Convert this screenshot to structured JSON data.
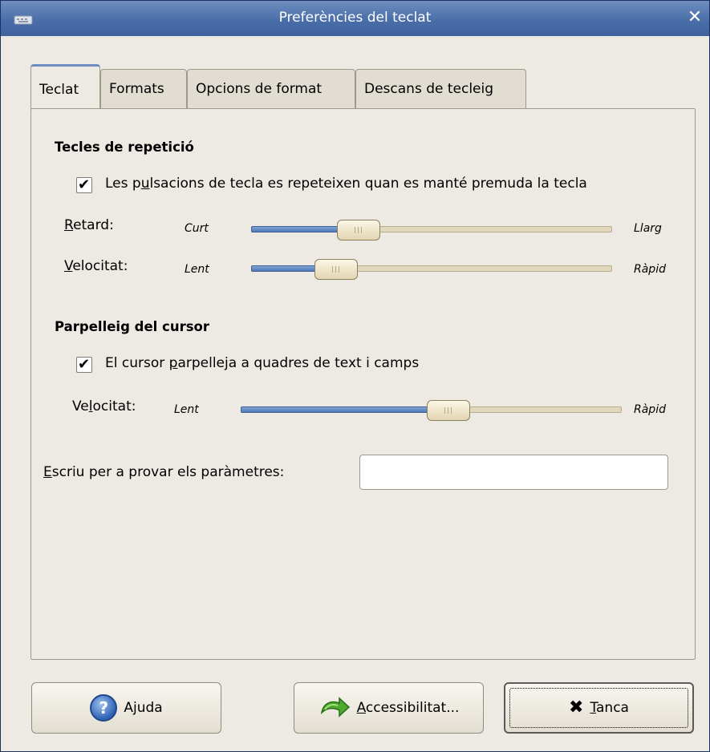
{
  "window": {
    "title": "Preferències del teclat",
    "close_glyph": "✕"
  },
  "tabs": [
    {
      "label": "Teclat",
      "active": true
    },
    {
      "label": "Formats",
      "active": false
    },
    {
      "label": "Opcions de format",
      "active": false
    },
    {
      "label": "Descans de tecleig",
      "active": false
    }
  ],
  "repeat": {
    "heading": "Tecles de repetició",
    "checkbox_label_pre": "Les p",
    "checkbox_label_mn": "u",
    "checkbox_label_post": "lsacions de tecla es repeteixen quan es manté premuda la tecla",
    "checked": true,
    "delay": {
      "label_mn": "R",
      "label_rest": "etard:",
      "min_label": "Curt",
      "max_label": "Llarg",
      "value": 0.27
    },
    "speed": {
      "label_mn": "V",
      "label_rest": "elocitat:",
      "min_label": "Lent",
      "max_label": "Ràpid",
      "value": 0.2
    }
  },
  "cursor": {
    "heading": "Parpelleig del cursor",
    "checkbox_label_pre": "El cursor ",
    "checkbox_label_mn": "p",
    "checkbox_label_post": "arpelleja a quadres de text i camps",
    "checked": true,
    "speed": {
      "label_pre": "Ve",
      "label_mn": "l",
      "label_rest": "ocitat:",
      "min_label": "Lent",
      "max_label": "Ràpid",
      "value": 0.55
    }
  },
  "test": {
    "label_mn": "E",
    "label_rest": "scriu per a provar els paràmetres:",
    "value": "",
    "placeholder": ""
  },
  "buttons": {
    "help": {
      "pre": "A",
      "mn": "j",
      "post": "uda",
      "icon": "help-icon"
    },
    "accessibility": {
      "mn": "A",
      "post": "ccessibilitat...",
      "icon": "accessibility-arrow-icon"
    },
    "close": {
      "mn": "T",
      "post": "anca",
      "icon": "close-x-icon"
    }
  },
  "colors": {
    "titlebar": "#4a6ea9",
    "slider_fill": "#4f78b6",
    "background": "#edeae3"
  }
}
